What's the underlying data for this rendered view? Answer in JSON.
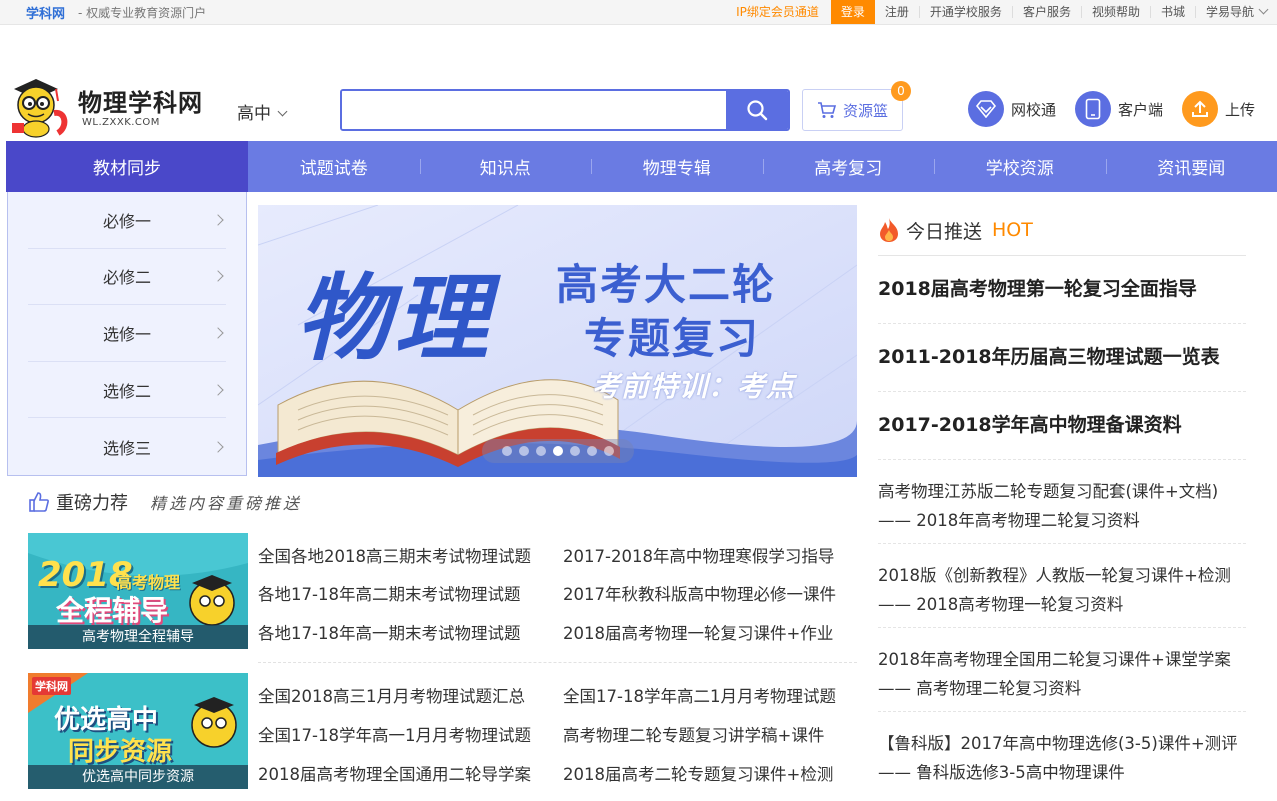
{
  "topbar": {
    "brand": "学科网",
    "slogan": "- 权威专业教育资源门户",
    "links": [
      "IP绑定会员通道",
      "登录",
      "注册",
      "开通学校服务",
      "客户服务",
      "视频帮助",
      "书城",
      "学易导航"
    ]
  },
  "header": {
    "logo_name": "物理学科网",
    "logo_domain": "WL.ZXXK.COM",
    "grade": "高中",
    "search_placeholder": "",
    "basket_label": "资源篮",
    "basket_count": "0",
    "icons": [
      {
        "label": "网校通",
        "icon": "diamond-icon",
        "color": "#5b6ee1"
      },
      {
        "label": "客户端",
        "icon": "tablet-icon",
        "color": "#5b6ee1"
      },
      {
        "label": "上传",
        "icon": "upload-icon",
        "color": "#ff9a1e"
      }
    ]
  },
  "nav": [
    "教材同步",
    "试题试卷",
    "知识点",
    "物理专辑",
    "高考复习",
    "学校资源",
    "资讯要闻"
  ],
  "sidemenu": [
    "必修一",
    "必修二",
    "选修一",
    "选修二",
    "选修三"
  ],
  "banner": {
    "big": "物理",
    "line1": "高考大二轮",
    "line2": "专题复习",
    "line3": "考前特训：考点",
    "active_slide": 4,
    "slide_count": 7
  },
  "recommend": {
    "title": "重磅力荐",
    "subtitle": "精选内容重磅推送",
    "blocks": [
      {
        "thumb_big": "2018",
        "thumb_line1": "高考物理",
        "thumb_line2": "全程辅导",
        "caption": "高考物理全程辅导",
        "links": [
          "全国各地2018高三期末考试物理试题",
          "2017-2018年高中物理寒假学习指导",
          "各地17-18年高二期末考试物理试题",
          "2017年秋教科版高中物理必修一课件",
          "各地17-18年高一期末考试物理试题",
          "2018届高考物理一轮复习课件+作业"
        ]
      },
      {
        "thumb_tag": "学科网",
        "thumb_line1": "优选高中",
        "thumb_line2": "同步资源",
        "caption": "优选高中同步资源",
        "links": [
          "全国2018高三1月月考物理试题汇总",
          "全国17-18学年高二1月月考物理试题",
          "全国17-18学年高一1月月考物理试题",
          "高考物理二轮专题复习讲学稿+课件",
          "2018届高考物理全国通用二轮导学案",
          "2018届高考二轮专题复习课件+检测"
        ]
      }
    ]
  },
  "today": {
    "title": "今日推送",
    "hot": "HOT",
    "big": [
      "2018届高考物理第一轮复习全面指导",
      "2011-2018年历届高三物理试题一览表",
      "2017-2018学年高中物理备课资料"
    ],
    "items": [
      {
        "a": "高考物理江苏版二轮专题复习配套(课件+文档)",
        "b": "—— 2018年高考物理二轮复习资料"
      },
      {
        "a": "2018版《创新教程》人教版一轮复习课件+检测",
        "b": "—— 2018高考物理一轮复习资料"
      },
      {
        "a": "2018年高考物理全国用二轮复习课件+课堂学案",
        "b": "—— 高考物理二轮复习资料"
      },
      {
        "a": "【鲁科版】2017年高中物理选修(3-5)课件+测评",
        "b": "—— 鲁科版选修3-5高中物理课件"
      }
    ]
  }
}
